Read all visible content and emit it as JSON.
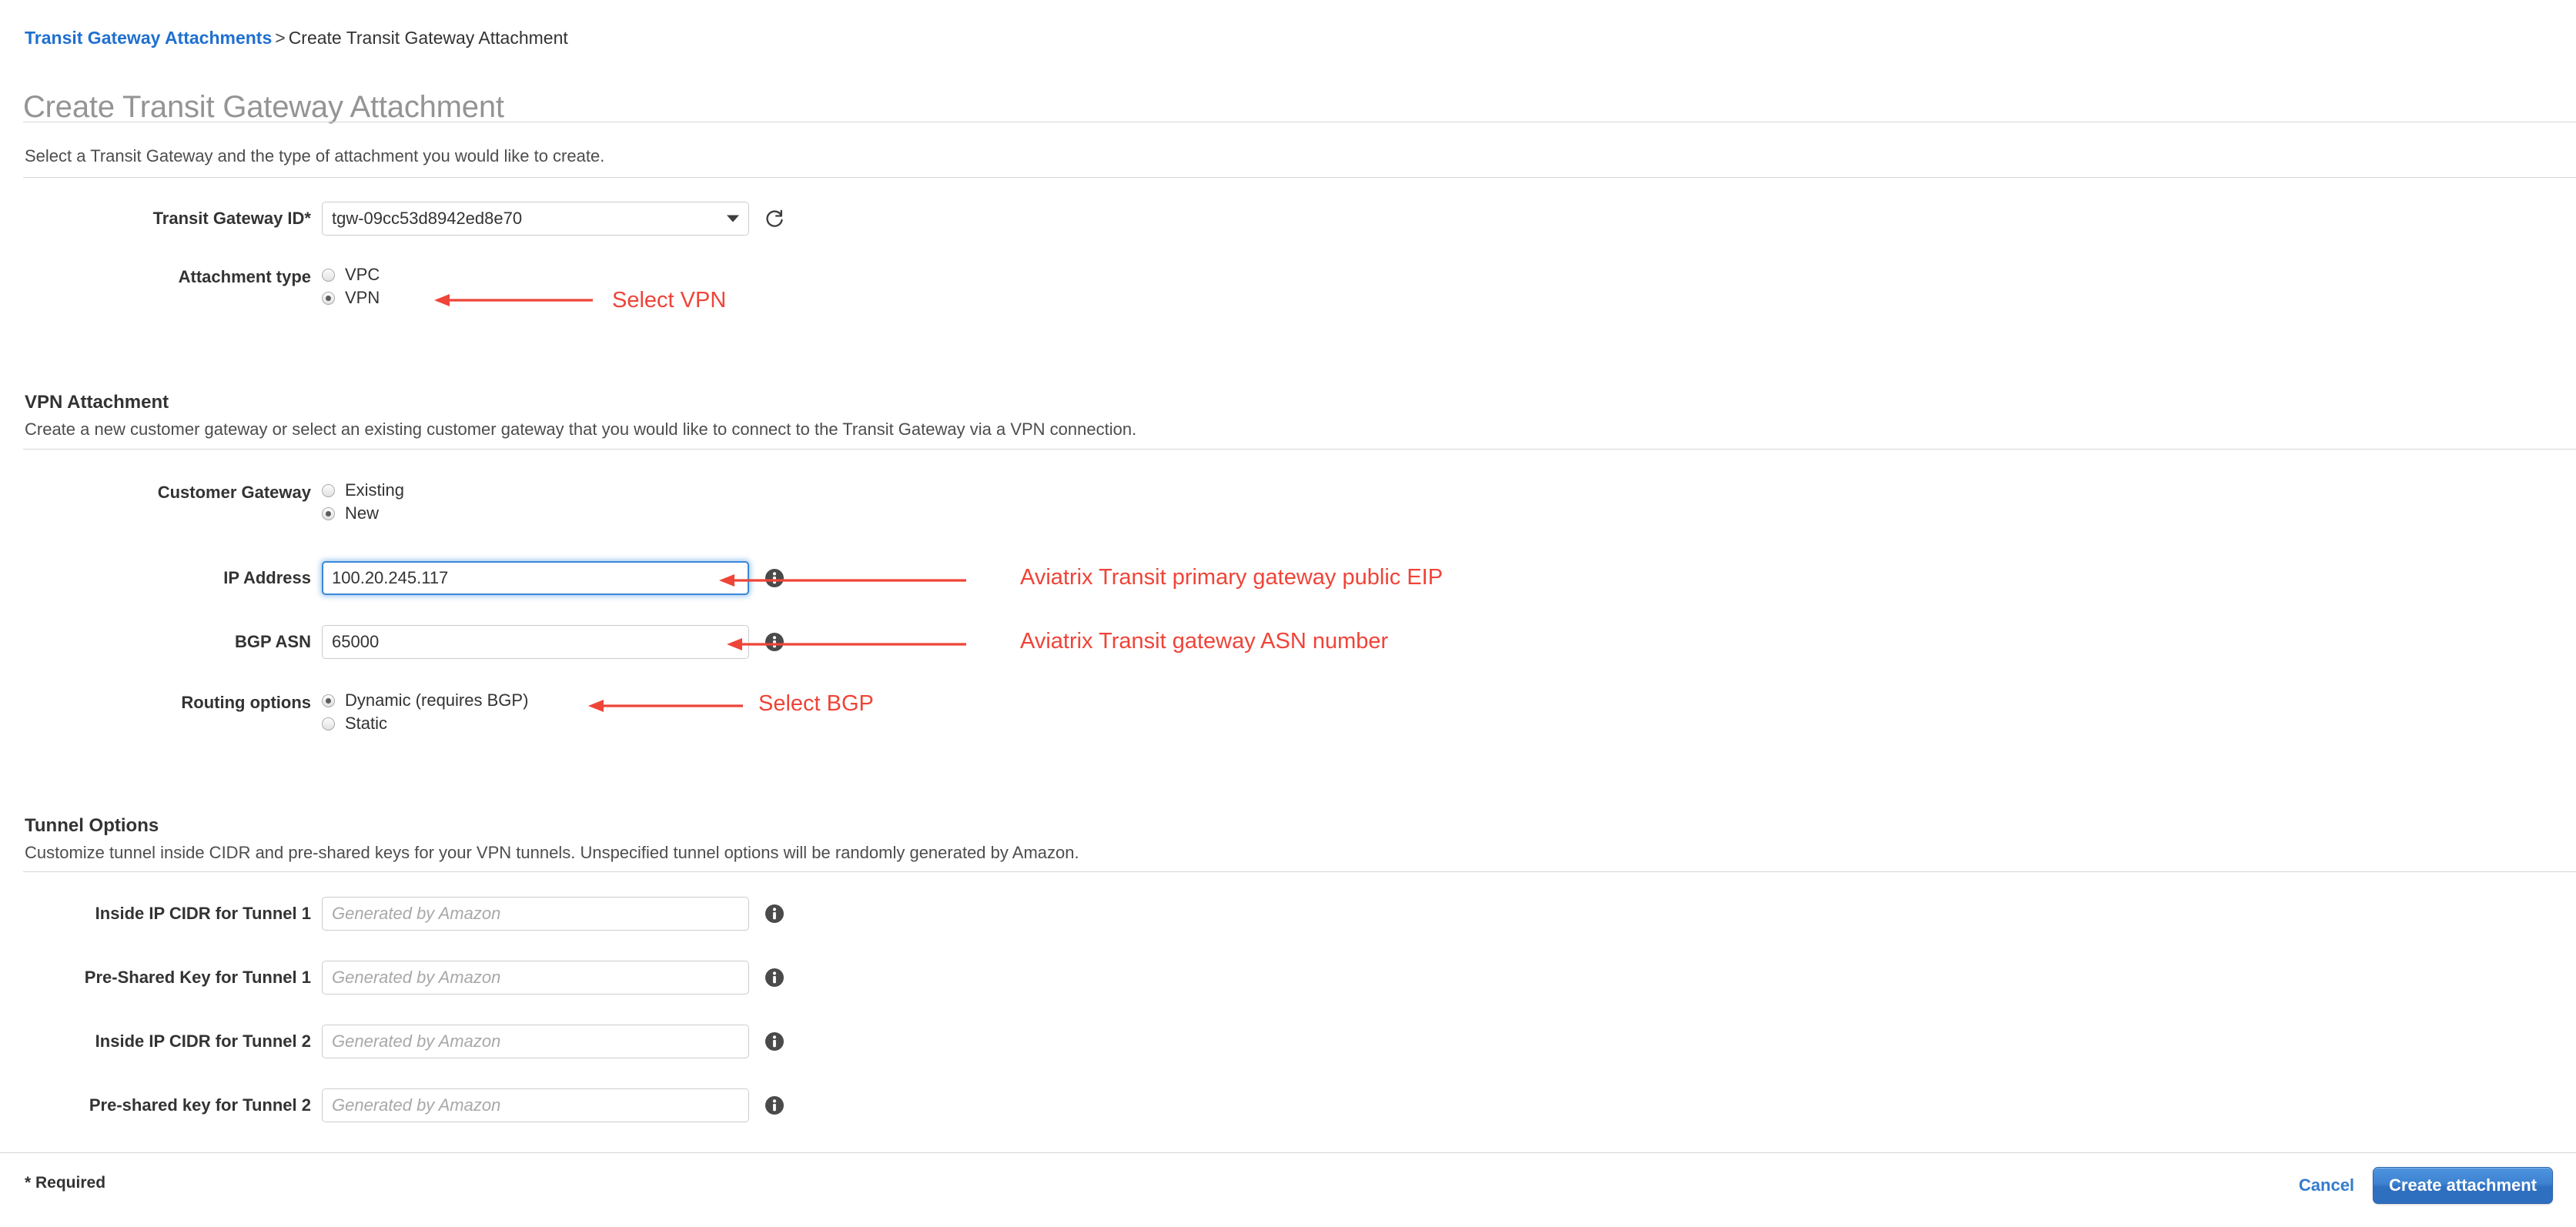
{
  "breadcrumb": {
    "link": "Transit Gateway Attachments",
    "separator": ">",
    "current": "Create Transit Gateway Attachment"
  },
  "page": {
    "title": "Create Transit Gateway Attachment",
    "intro": "Select a Transit Gateway and the type of attachment you would like to create."
  },
  "transit_gateway": {
    "label": "Transit Gateway ID*",
    "value": "tgw-09cc53d8942ed8e70",
    "refresh_icon": "refresh-icon",
    "caret_icon": "chevron-down-icon"
  },
  "attachment_type": {
    "label": "Attachment type",
    "options": [
      {
        "label": "VPC",
        "selected": false
      },
      {
        "label": "VPN",
        "selected": true
      }
    ]
  },
  "vpn_attachment": {
    "heading": "VPN Attachment",
    "description": "Create a new customer gateway or select an existing customer gateway that you would like to connect to the Transit Gateway via a VPN connection.",
    "customer_gateway": {
      "label": "Customer Gateway",
      "options": [
        {
          "label": "Existing",
          "selected": false
        },
        {
          "label": "New",
          "selected": true
        }
      ]
    },
    "ip_address": {
      "label": "IP Address",
      "value": "100.20.245.117",
      "focused": true
    },
    "bgp_asn": {
      "label": "BGP ASN",
      "value": "65000",
      "focused": false
    },
    "routing_options": {
      "label": "Routing options",
      "options": [
        {
          "label": "Dynamic (requires BGP)",
          "selected": true
        },
        {
          "label": "Static",
          "selected": false
        }
      ]
    }
  },
  "tunnel_options": {
    "heading": "Tunnel Options",
    "description": "Customize tunnel inside CIDR and pre-shared keys for your VPN tunnels. Unspecified tunnel options will be randomly generated by Amazon.",
    "fields": [
      {
        "label": "Inside IP CIDR for Tunnel 1",
        "placeholder": "Generated by Amazon",
        "value": ""
      },
      {
        "label": "Pre-Shared Key for Tunnel 1",
        "placeholder": "Generated by Amazon",
        "value": ""
      },
      {
        "label": "Inside IP CIDR for Tunnel 2",
        "placeholder": "Generated by Amazon",
        "value": ""
      },
      {
        "label": "Pre-shared key for Tunnel 2",
        "placeholder": "Generated by Amazon",
        "value": ""
      }
    ]
  },
  "footer": {
    "required_note": "* Required",
    "cancel_label": "Cancel",
    "submit_label": "Create attachment"
  },
  "annotations": [
    {
      "text": "Select VPN",
      "target": "attachment-type-vpn"
    },
    {
      "text": "Aviatrix Transit primary gateway public EIP",
      "target": "ip-address-field"
    },
    {
      "text": "Aviatrix Transit gateway ASN number",
      "target": "bgp-asn-field"
    },
    {
      "text": "Select BGP",
      "target": "routing-options-dynamic"
    }
  ],
  "colors": {
    "annotation_red": "#ef4438",
    "link_blue": "#1f6fd0",
    "primary_button_blue": "#2f6fc0",
    "title_gray": "#949494"
  }
}
